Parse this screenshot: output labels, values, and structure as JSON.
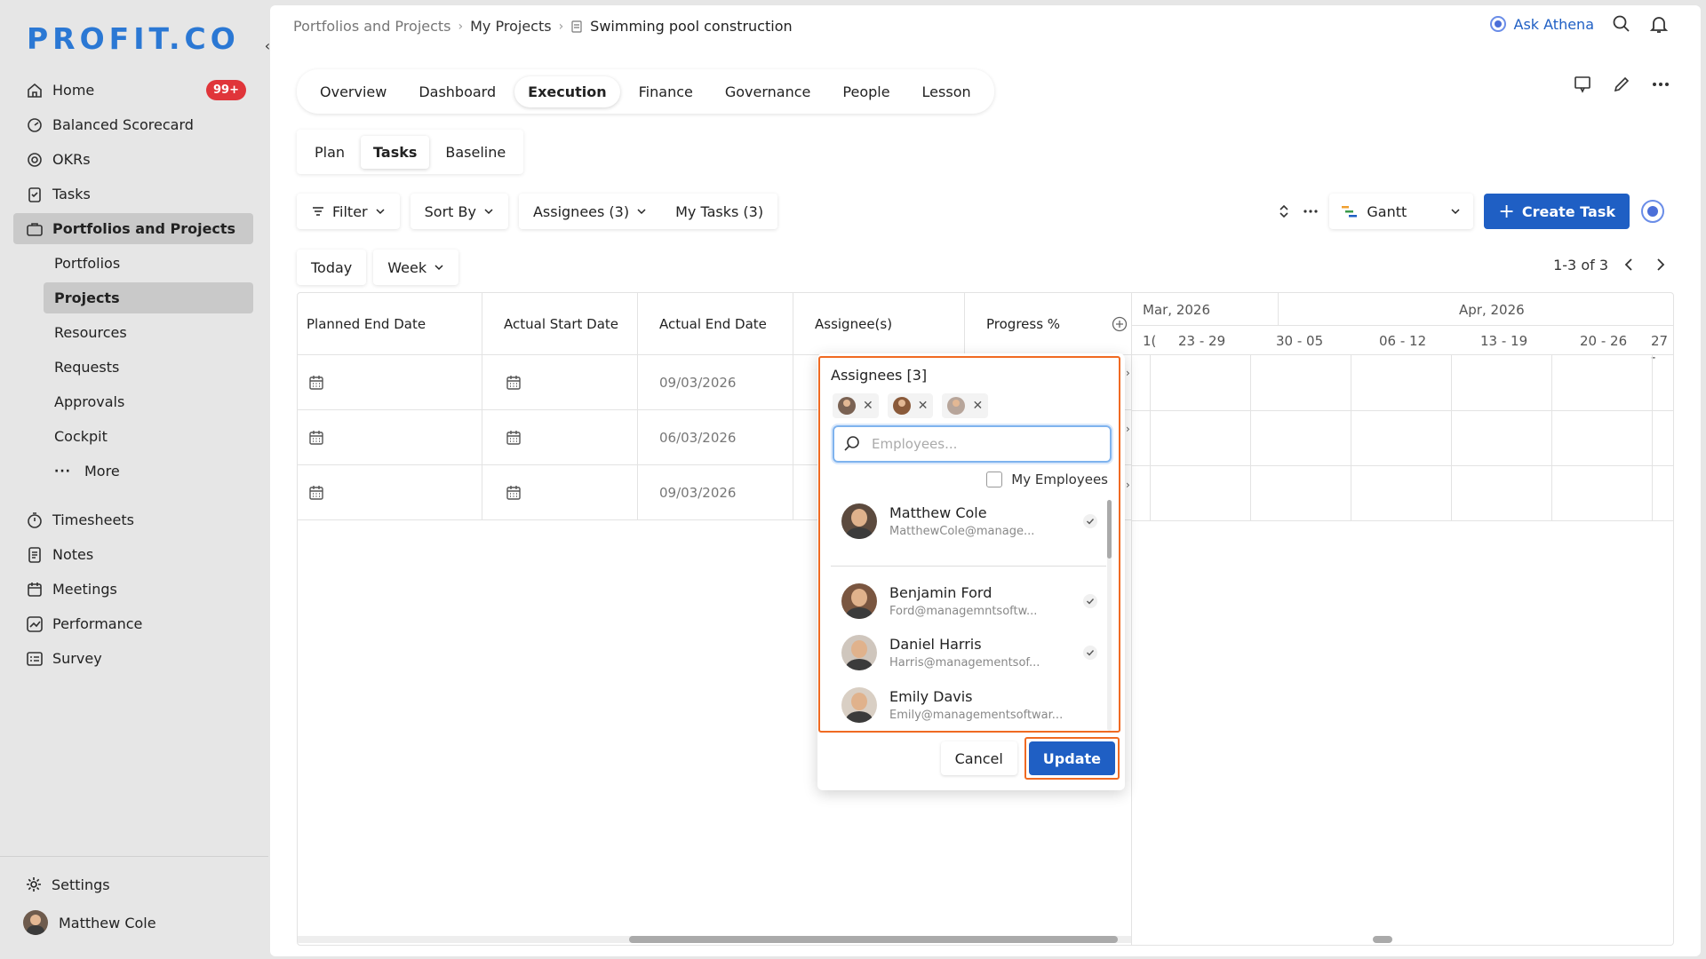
{
  "brand": {
    "logo": "PROFIT.CO"
  },
  "sidebar": {
    "items": [
      {
        "label": "Home",
        "badge": "99+"
      },
      {
        "label": "Balanced Scorecard"
      },
      {
        "label": "OKRs"
      },
      {
        "label": "Tasks"
      },
      {
        "label": "Portfolios and Projects"
      }
    ],
    "sub_items": [
      "Portfolios",
      "Projects",
      "Resources",
      "Requests",
      "Approvals",
      "Cockpit",
      "More"
    ],
    "items2": [
      "Timesheets",
      "Notes",
      "Meetings",
      "Performance",
      "Survey"
    ],
    "settings": "Settings",
    "user": "Matthew Cole"
  },
  "breadcrumb": {
    "b1": "Portfolios and Projects",
    "b2": "My Projects",
    "current": "Swimming pool construction"
  },
  "header": {
    "ask": "Ask Athena"
  },
  "tabs": [
    "Overview",
    "Dashboard",
    "Execution",
    "Finance",
    "Governance",
    "People",
    "Lesson"
  ],
  "subtabs": [
    "Plan",
    "Tasks",
    "Baseline"
  ],
  "filters": {
    "filter": "Filter",
    "sort": "Sort By",
    "assignees": "Assignees (3)",
    "mytasks": "My Tasks (3)"
  },
  "view": {
    "gantt": "Gantt",
    "create": "Create Task"
  },
  "datebar": {
    "today": "Today",
    "week": "Week"
  },
  "pager": {
    "text": "1-3 of 3"
  },
  "table": {
    "columns": [
      "Planned End Date",
      "Actual Start Date",
      "Actual End Date",
      "Assignee(s)",
      "Progress %"
    ],
    "rows": [
      {
        "actual_end": "09/03/2026"
      },
      {
        "actual_end": "06/03/2026"
      },
      {
        "actual_end": "09/03/2026"
      }
    ]
  },
  "gantt": {
    "months": [
      "Mar, 2026",
      "Apr, 2026"
    ],
    "weeks": [
      "1(",
      "23 - 29",
      "30 - 05",
      "06 - 12",
      "13 - 19",
      "20 - 26",
      "27 -"
    ]
  },
  "popup": {
    "title": "Assignees [3]",
    "search_placeholder": "Employees...",
    "my_employees": "My Employees",
    "employees": [
      {
        "name": "Matthew Cole",
        "email": "MatthewCole@manage...",
        "checked": true
      },
      {
        "name": "Benjamin Ford",
        "email": "Ford@managemntsoftw...",
        "checked": true
      },
      {
        "name": "Daniel Harris",
        "email": "Harris@managementsof...",
        "checked": true
      },
      {
        "name": "Emily Davis",
        "email": "Emily@managementsoftwar...",
        "checked": false
      }
    ],
    "cancel": "Cancel",
    "update": "Update"
  },
  "colors": {
    "accent": "#1f5fc4",
    "highlight": "#f06a22",
    "badge": "#e0353a"
  }
}
